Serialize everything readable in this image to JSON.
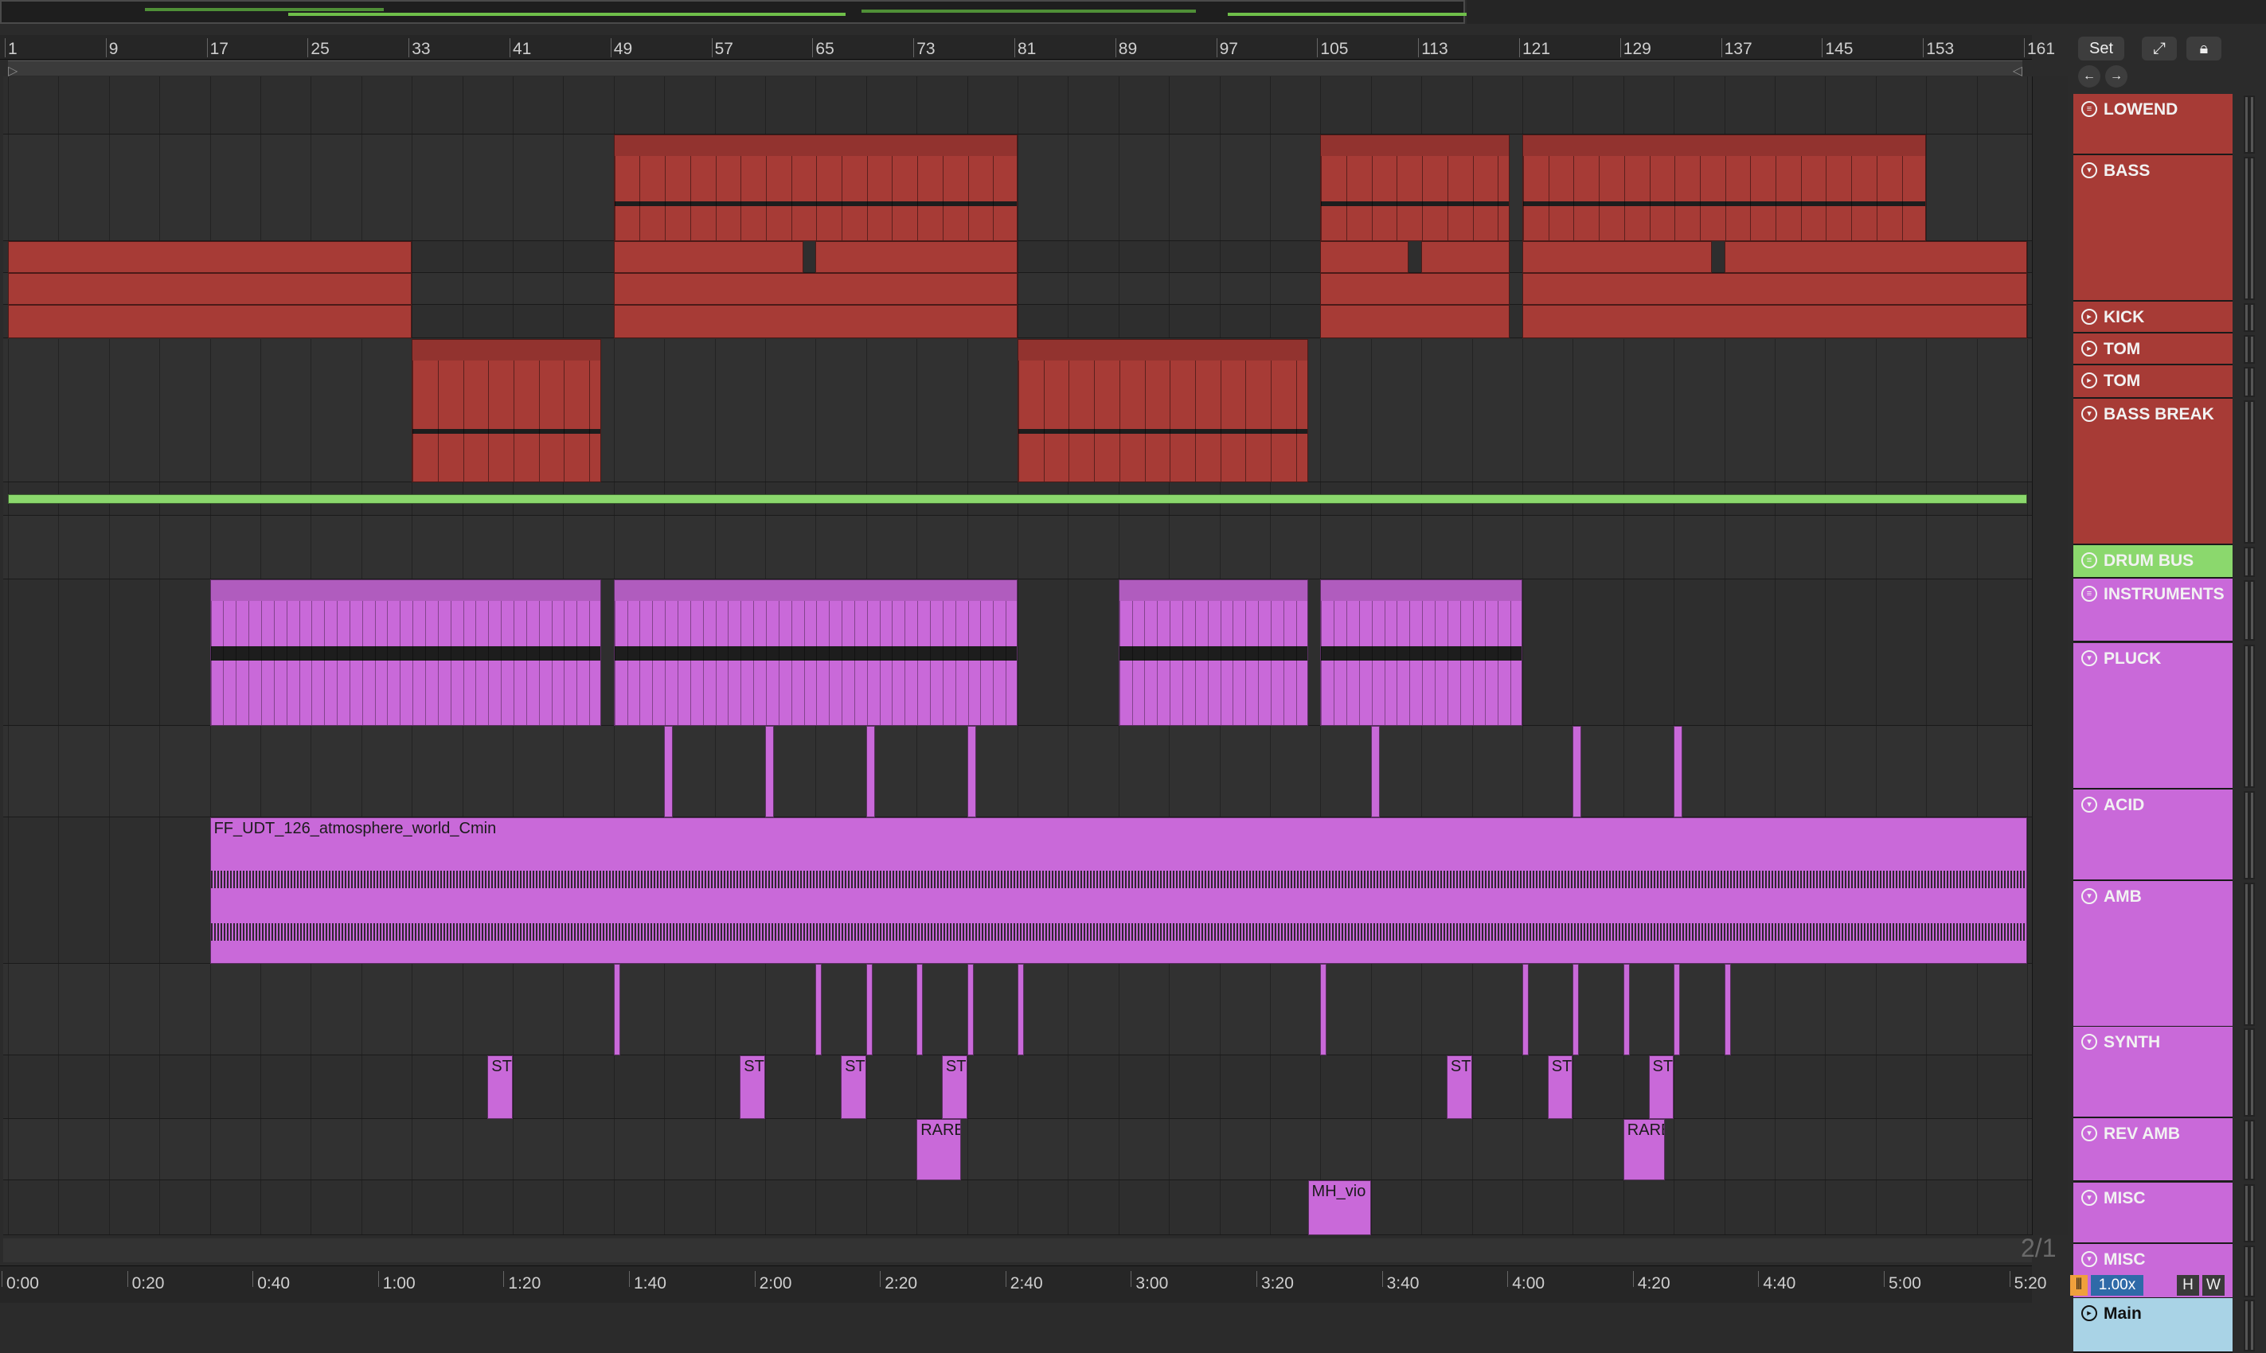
{
  "grid_ratio": "2/1",
  "controls": {
    "set_label": "Set",
    "zoom": "1.00x",
    "h_label": "H",
    "w_label": "W"
  },
  "colors": {
    "red": "#a73b36",
    "purple": "#c969d9",
    "green": "#8bd86d",
    "main": "#a9d3e6",
    "background": "#2b2b2b"
  },
  "ruler": {
    "bar_labels": [
      "1",
      "9",
      "17",
      "25",
      "33",
      "41",
      "49",
      "57",
      "65",
      "73",
      "81",
      "89",
      "97",
      "105",
      "113",
      "121",
      "129",
      "137",
      "145",
      "153",
      "161"
    ],
    "time_labels": [
      "0:00",
      "0:20",
      "0:40",
      "1:00",
      "1:20",
      "1:40",
      "2:00",
      "2:20",
      "2:40",
      "3:00",
      "3:20",
      "3:40",
      "4:00",
      "4:20",
      "4:40",
      "5:00",
      "5:20"
    ]
  },
  "tracks": [
    {
      "name": "LOWEND",
      "kind": "group",
      "color": "#a73b36",
      "icon": "group-icon"
    },
    {
      "name": "BASS",
      "kind": "midi",
      "color": "#a73b36",
      "icon": "fold-down-icon"
    },
    {
      "name": "KICK",
      "kind": "audio",
      "color": "#a73b36",
      "icon": "fold-right-icon"
    },
    {
      "name": "TOM",
      "kind": "audio",
      "color": "#a73b36",
      "icon": "fold-right-icon"
    },
    {
      "name": "TOM",
      "kind": "audio",
      "color": "#a73b36",
      "icon": "fold-right-icon"
    },
    {
      "name": "BASS BREAK",
      "kind": "midi",
      "color": "#a73b36",
      "icon": "fold-down-icon"
    },
    {
      "name": "DRUM BUS",
      "kind": "group",
      "color": "#8bd86d",
      "icon": "group-icon"
    },
    {
      "name": "INSTRUMENTS",
      "kind": "group",
      "color": "#c969d9",
      "icon": "group-icon"
    },
    {
      "name": "PLUCK",
      "kind": "midi",
      "color": "#c969d9",
      "icon": "fold-down-icon"
    },
    {
      "name": "ACID",
      "kind": "midi",
      "color": "#c969d9",
      "icon": "fold-down-icon"
    },
    {
      "name": "AMB",
      "kind": "audio",
      "color": "#c969d9",
      "icon": "fold-down-icon"
    },
    {
      "name": "SYNTH",
      "kind": "midi",
      "color": "#c969d9",
      "icon": "fold-down-icon"
    },
    {
      "name": "REV AMB",
      "kind": "audio",
      "color": "#c969d9",
      "icon": "fold-down-icon"
    },
    {
      "name": "MISC",
      "kind": "audio",
      "color": "#c969d9",
      "icon": "fold-down-icon"
    },
    {
      "name": "MISC",
      "kind": "audio",
      "color": "#c969d9",
      "icon": "fold-down-icon"
    },
    {
      "name": "Main",
      "kind": "main",
      "color": "#a9d3e6",
      "icon": "fold-right-icon"
    }
  ],
  "clips": [
    {
      "track": 1,
      "color": "red",
      "start": 49,
      "end": 81,
      "title": ""
    },
    {
      "track": 1,
      "color": "red",
      "start": 105,
      "end": 120,
      "title": ""
    },
    {
      "track": 1,
      "color": "red",
      "start": 121,
      "end": 153,
      "title": ""
    },
    {
      "track": 2,
      "color": "red",
      "start": 1,
      "end": 33,
      "title": ""
    },
    {
      "track": 2,
      "color": "red",
      "start": 49,
      "end": 64,
      "title": ""
    },
    {
      "track": 2,
      "color": "red",
      "start": 65,
      "end": 81,
      "title": ""
    },
    {
      "track": 2,
      "color": "red",
      "start": 105,
      "end": 112,
      "title": ""
    },
    {
      "track": 2,
      "color": "red",
      "start": 113,
      "end": 120,
      "title": ""
    },
    {
      "track": 2,
      "color": "red",
      "start": 121,
      "end": 136,
      "title": ""
    },
    {
      "track": 2,
      "color": "red",
      "start": 137,
      "end": 161,
      "title": ""
    },
    {
      "track": 3,
      "color": "red",
      "start": 1,
      "end": 33,
      "title": ""
    },
    {
      "track": 3,
      "color": "red",
      "start": 49,
      "end": 81,
      "title": ""
    },
    {
      "track": 3,
      "color": "red",
      "start": 105,
      "end": 120,
      "title": ""
    },
    {
      "track": 3,
      "color": "red",
      "start": 121,
      "end": 161,
      "title": ""
    },
    {
      "track": 4,
      "color": "red",
      "start": 1,
      "end": 33,
      "title": ""
    },
    {
      "track": 4,
      "color": "red",
      "start": 49,
      "end": 81,
      "title": ""
    },
    {
      "track": 4,
      "color": "red",
      "start": 105,
      "end": 120,
      "title": ""
    },
    {
      "track": 4,
      "color": "red",
      "start": 121,
      "end": 161,
      "title": ""
    },
    {
      "track": 5,
      "color": "red",
      "start": 33,
      "end": 48,
      "title": ""
    },
    {
      "track": 5,
      "color": "red",
      "start": 81,
      "end": 104,
      "title": ""
    },
    {
      "track": 6,
      "color": "green",
      "start": 1,
      "end": 161,
      "title": ""
    },
    {
      "track": 8,
      "color": "purple",
      "start": 17,
      "end": 48,
      "title": ""
    },
    {
      "track": 8,
      "color": "purple",
      "start": 49,
      "end": 81,
      "title": ""
    },
    {
      "track": 8,
      "color": "purple",
      "start": 89,
      "end": 104,
      "title": ""
    },
    {
      "track": 8,
      "color": "purple",
      "start": 105,
      "end": 121,
      "title": ""
    },
    {
      "track": 9,
      "color": "purple",
      "start": 53,
      "end": 53.7,
      "title": ""
    },
    {
      "track": 9,
      "color": "purple",
      "start": 61,
      "end": 61.7,
      "title": ""
    },
    {
      "track": 9,
      "color": "purple",
      "start": 69,
      "end": 69.7,
      "title": ""
    },
    {
      "track": 9,
      "color": "purple",
      "start": 77,
      "end": 77.7,
      "title": ""
    },
    {
      "track": 9,
      "color": "purple",
      "start": 109,
      "end": 109.7,
      "title": ""
    },
    {
      "track": 9,
      "color": "purple",
      "start": 125,
      "end": 125.7,
      "title": ""
    },
    {
      "track": 9,
      "color": "purple",
      "start": 133,
      "end": 133.7,
      "title": ""
    },
    {
      "track": 10,
      "color": "purple",
      "start": 17,
      "end": 161,
      "title": "FF_UDT_126_atmosphere_world_Cmin"
    },
    {
      "track": 11,
      "color": "purple",
      "start": 49,
      "end": 49.5,
      "title": ""
    },
    {
      "track": 11,
      "color": "purple",
      "start": 65,
      "end": 65.5,
      "title": ""
    },
    {
      "track": 11,
      "color": "purple",
      "start": 69,
      "end": 69.5,
      "title": ""
    },
    {
      "track": 11,
      "color": "purple",
      "start": 73,
      "end": 73.5,
      "title": ""
    },
    {
      "track": 11,
      "color": "purple",
      "start": 77,
      "end": 77.5,
      "title": ""
    },
    {
      "track": 11,
      "color": "purple",
      "start": 81,
      "end": 81.5,
      "title": ""
    },
    {
      "track": 11,
      "color": "purple",
      "start": 105,
      "end": 105.5,
      "title": ""
    },
    {
      "track": 11,
      "color": "purple",
      "start": 121,
      "end": 121.5,
      "title": ""
    },
    {
      "track": 11,
      "color": "purple",
      "start": 125,
      "end": 125.5,
      "title": ""
    },
    {
      "track": 11,
      "color": "purple",
      "start": 129,
      "end": 129.5,
      "title": ""
    },
    {
      "track": 11,
      "color": "purple",
      "start": 133,
      "end": 133.5,
      "title": ""
    },
    {
      "track": 11,
      "color": "purple",
      "start": 137,
      "end": 137.5,
      "title": ""
    },
    {
      "track": 12,
      "color": "purple",
      "start": 39,
      "end": 41,
      "title": "ST"
    },
    {
      "track": 12,
      "color": "purple",
      "start": 59,
      "end": 61,
      "title": "ST"
    },
    {
      "track": 12,
      "color": "purple",
      "start": 67,
      "end": 69,
      "title": "ST"
    },
    {
      "track": 12,
      "color": "purple",
      "start": 75,
      "end": 77,
      "title": "ST"
    },
    {
      "track": 12,
      "color": "purple",
      "start": 115,
      "end": 117,
      "title": "ST"
    },
    {
      "track": 12,
      "color": "purple",
      "start": 123,
      "end": 125,
      "title": "ST"
    },
    {
      "track": 12,
      "color": "purple",
      "start": 131,
      "end": 133,
      "title": "ST"
    },
    {
      "track": 13,
      "color": "purple",
      "start": 73,
      "end": 76.5,
      "title": "RARE"
    },
    {
      "track": 13,
      "color": "purple",
      "start": 129,
      "end": 132.3,
      "title": "RARE"
    },
    {
      "track": 14,
      "color": "purple",
      "start": 104,
      "end": 109,
      "title": "MH_vio"
    }
  ]
}
